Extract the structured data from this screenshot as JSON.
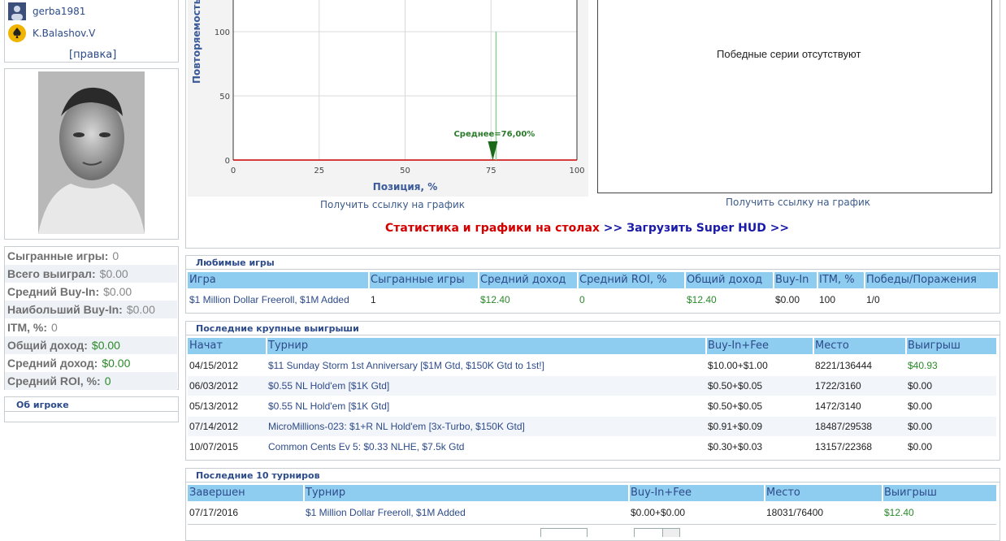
{
  "friends": [
    {
      "name": "gerba1981"
    },
    {
      "name": "K.Balashov.V"
    }
  ],
  "edit_link": "[правка]",
  "player_stats": [
    {
      "label": "Сыгранные игры:",
      "value": "0"
    },
    {
      "label": "Всего выиграл:",
      "value": "$0.00"
    },
    {
      "label": "Средний Buy-In:",
      "value": "$0.00"
    },
    {
      "label": "Наибольший Buy-In:",
      "value": "$0.00"
    },
    {
      "label": "ITM, %:",
      "value": "0"
    },
    {
      "label": "Общий доход:",
      "value": "$0.00"
    },
    {
      "label": "Средний доход:",
      "value": "$0.00"
    },
    {
      "label": "Средний ROI, %:",
      "value": "0"
    }
  ],
  "about_player": "Об игроке",
  "chart_data": {
    "type": "bar",
    "xlabel": "Позиция, %",
    "ylabel": "Повторяемость",
    "xlim": [
      0,
      100
    ],
    "ylim": [
      0,
      100
    ],
    "xticks": [
      "0",
      "25",
      "50",
      "75",
      "100"
    ],
    "yticks": [
      "0",
      "50",
      "100"
    ],
    "bars": [
      {
        "x": 76,
        "y": 100
      }
    ],
    "annotation": "Среднее=76,00%",
    "mean_x": 76
  },
  "get_chart_link_1": "Получить ссылку на график",
  "no_streaks_text": "Победные серии отсутствуют",
  "get_chart_link_2": "Получить ссылку на график",
  "promo": {
    "red": "Статистика и графики на столах",
    "blue": ">> Загрузить Super HUD >>"
  },
  "favorite_games": {
    "title": "Любимые игры",
    "headers": [
      "Игра",
      "Сыгранные игры",
      "Средний доход",
      "Средний ROI, %",
      "Общий доход",
      "Buy-In",
      "ITM, %",
      "Победы/Поражения"
    ],
    "rows": [
      [
        "$1 Million Dollar Freeroll, $1M Added",
        "1",
        "$12.40",
        "0",
        "$12.40",
        "$0.00",
        "100",
        "1/0"
      ]
    ]
  },
  "big_wins": {
    "title": "Последние крупные выигрыши",
    "headers": [
      "Начат",
      "Турнир",
      "Buy-In+Fee",
      "Место",
      "Выигрыш"
    ],
    "rows": [
      [
        "04/15/2012",
        "$11 Sunday Storm 1st Anniversary [$1M Gtd, $150K Gtd to 1st!]",
        "$10.00+$1.00",
        "8221/136444",
        "$40.93"
      ],
      [
        "06/03/2012",
        "$0.55 NL Hold'em [$1K Gtd]",
        "$0.50+$0.05",
        "1722/3160",
        "$0.00"
      ],
      [
        "05/13/2012",
        "$0.55 NL Hold'em [$1K Gtd]",
        "$0.50+$0.05",
        "1472/3140",
        "$0.00"
      ],
      [
        "07/14/2012",
        "MicroMillions-023: $1+R NL Hold'em [3x-Turbo, $150K Gtd]",
        "$0.91+$0.09",
        "18487/29538",
        "$0.00"
      ],
      [
        "10/07/2015",
        "Common Cents Ev 5: $0.33 NLHE, $7.5k Gtd",
        "$0.30+$0.03",
        "13157/22368",
        "$0.00"
      ]
    ]
  },
  "last_tournaments": {
    "title": "Последние 10 турниров",
    "headers": [
      "Завершен",
      "Турнир",
      "Buy-In+Fee",
      "Место",
      "Выигрыш"
    ],
    "rows": [
      [
        "07/17/2016",
        "$1 Million Dollar Freeroll, $1M Added",
        "$0.00+$0.00",
        "18031/76400",
        "$12.40"
      ]
    ]
  }
}
